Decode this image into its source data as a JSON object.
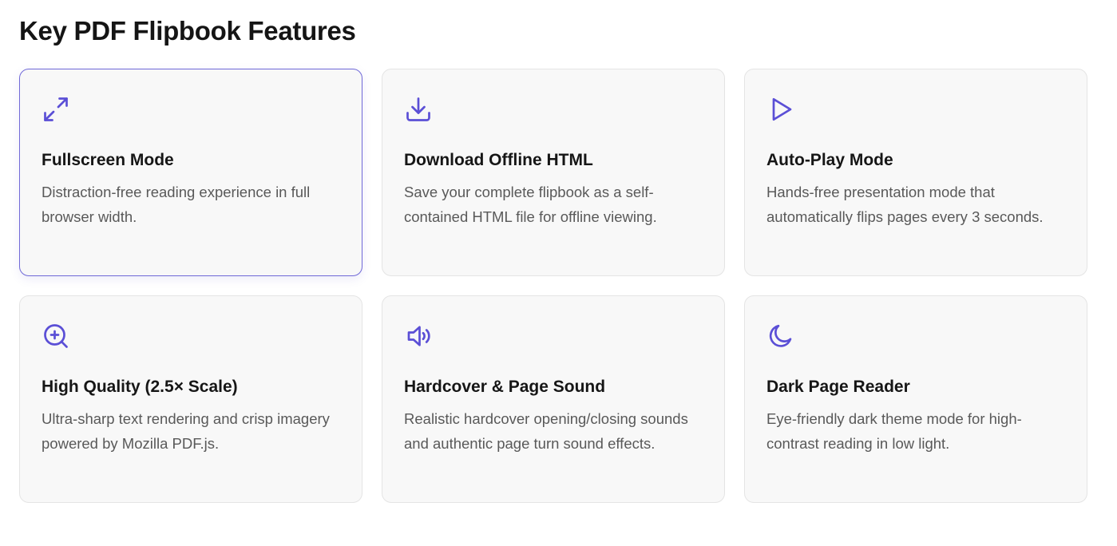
{
  "section": {
    "title": "Key PDF Flipbook Features"
  },
  "theme": {
    "accent": "#5b4fd6",
    "card_bg": "#f8f8f8",
    "active_border": "#7069d8"
  },
  "features": [
    {
      "icon": "expand-arrows-icon",
      "title": "Fullscreen Mode",
      "description": "Distraction-free reading experience in full browser width."
    },
    {
      "icon": "download-icon",
      "title": "Download Offline HTML",
      "description": "Save your complete flipbook as a self-contained HTML file for offline viewing."
    },
    {
      "icon": "play-icon",
      "title": "Auto-Play Mode",
      "description": "Hands-free presentation mode that automatically flips pages every 3 seconds."
    },
    {
      "icon": "zoom-in-icon",
      "title": "High Quality (2.5× Scale)",
      "description": "Ultra-sharp text rendering and crisp imagery powered by Mozilla PDF.js."
    },
    {
      "icon": "speaker-icon",
      "title": "Hardcover & Page Sound",
      "description": "Realistic hardcover opening/closing sounds and authentic page turn sound effects."
    },
    {
      "icon": "moon-icon",
      "title": "Dark Page Reader",
      "description": "Eye-friendly dark theme mode for high-contrast reading in low light."
    }
  ]
}
